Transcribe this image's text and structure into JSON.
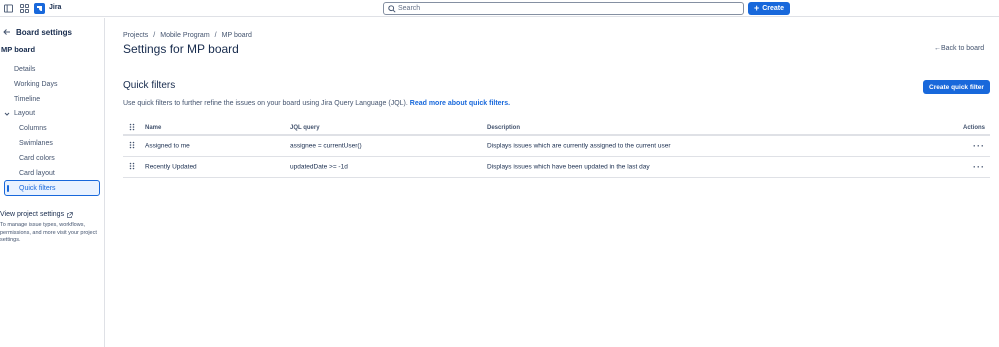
{
  "topbar": {
    "app_name": "Jira",
    "search_placeholder": "Search",
    "create_label": "Create",
    "create_icon": "plus-icon"
  },
  "sidebar": {
    "header": "Board settings",
    "board_name": "MP board",
    "items": [
      {
        "label": "Details"
      },
      {
        "label": "Working Days"
      },
      {
        "label": "Timeline"
      }
    ],
    "layout_label": "Layout",
    "layout_items": [
      {
        "label": "Columns"
      },
      {
        "label": "Swimlanes"
      },
      {
        "label": "Card colors"
      },
      {
        "label": "Card layout"
      }
    ],
    "selected_item": "Quick filters",
    "view_project_settings": "View project settings",
    "view_project_settings_desc": "To manage issue types, workflows, permissions, and more visit your project settings."
  },
  "main": {
    "breadcrumb": [
      "Projects",
      "Mobile Program",
      "MP board"
    ],
    "breadcrumb_sep": "/",
    "page_title": "Settings for MP board",
    "back_link": "Back to board",
    "section_title": "Quick filters",
    "create_quick_filter": "Create quick filter",
    "description_text": "Use quick filters to further refine the issues on your board using Jira Query Language (JQL).",
    "description_link": "Read more about quick filters.",
    "table": {
      "headers": {
        "name": "Name",
        "jql": "JQL query",
        "description": "Description",
        "actions": "Actions"
      },
      "rows": [
        {
          "name": "Assigned to me",
          "jql": "assignee = currentUser()",
          "description": "Displays issues which are currently assigned to the current user",
          "actions": "···"
        },
        {
          "name": "Recently Updated",
          "jql": "updatedDate >= -1d",
          "description": "Displays issues which have been updated in the last day",
          "actions": "···"
        }
      ]
    }
  },
  "colors": {
    "brand": "#1868db",
    "text": "#172b4d",
    "subtle": "#44546f",
    "border": "#dfe1e6"
  }
}
